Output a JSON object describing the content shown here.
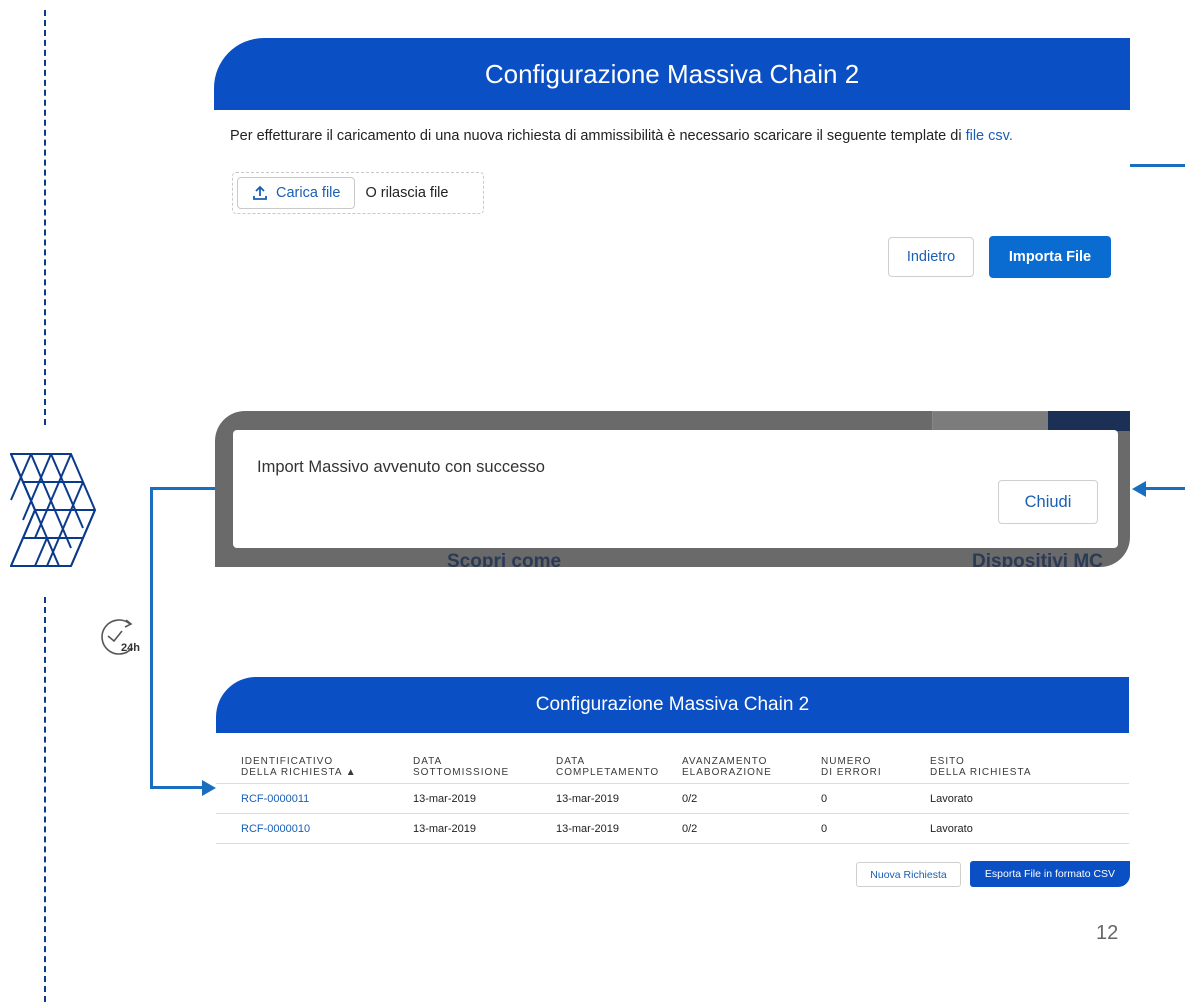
{
  "panel_top": {
    "title": "Configurazione Massiva Chain 2",
    "intro_text": "Per effetturare il caricamento di una nuova richiesta di ammissibilità è necessario scaricare il seguente template di ",
    "intro_link": "file csv.",
    "upload_label": "Carica file",
    "drop_label": "O rilascia file",
    "back_label": "Indietro",
    "import_label": "Importa File"
  },
  "modal": {
    "message": "Import Massivo avvenuto con successo",
    "close_label": "Chiudi",
    "background_left_text": "Scopri come",
    "background_right_text": "Dispositivi MC"
  },
  "clock": {
    "label": "24h"
  },
  "panel_bottom": {
    "title": "Configurazione Massiva Chain 2",
    "columns": [
      [
        "IDENTIFICATIVO",
        "DELLA RICHIESTA  ▲"
      ],
      [
        "DATA",
        "SOTTOMISSIONE"
      ],
      [
        "DATA",
        "COMPLETAMENTO"
      ],
      [
        "AVANZAMENTO",
        "ELABORAZIONE"
      ],
      [
        "NUMERO",
        "DI ERRORI"
      ],
      [
        "ESITO",
        "DELLA RICHIESTA"
      ]
    ],
    "rows": [
      [
        "RCF-0000011",
        "13-mar-2019",
        "13-mar-2019",
        "0/2",
        "0",
        "Lavorato"
      ],
      [
        "RCF-0000010",
        "13-mar-2019",
        "13-mar-2019",
        "0/2",
        "0",
        "Lavorato"
      ]
    ],
    "new_request_label": "Nuova Richiesta",
    "export_label": "Esporta File in formato CSV"
  },
  "page_number": "12",
  "colors": {
    "brand_blue": "#0a4fc4",
    "link_blue": "#1a5fb4",
    "connector": "#1a6ec0"
  }
}
